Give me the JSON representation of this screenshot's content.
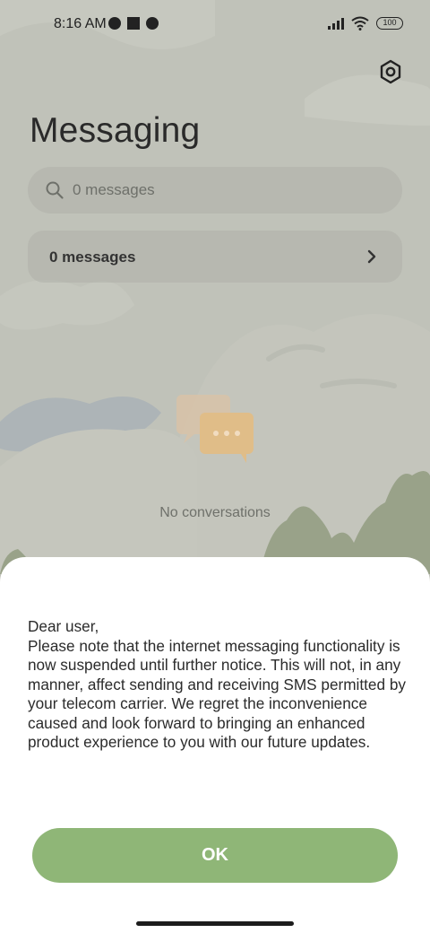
{
  "status_bar": {
    "time": "8:16 AM",
    "battery": "100"
  },
  "header": {
    "title": "Messaging",
    "settings_icon": "settings-hexagon-icon"
  },
  "search": {
    "placeholder": "0 messages",
    "icon": "search-icon"
  },
  "messages_row": {
    "label": "0 messages",
    "icon": "chevron-right-icon"
  },
  "empty_state": {
    "icon": "chat-bubbles-icon",
    "text": "No conversations"
  },
  "dialog": {
    "greeting": "Dear user,",
    "body": "Please note that the internet messaging functionality is now suspended until further notice. This will not, in any manner, affect sending and receiving SMS permitted by your telecom carrier. We regret the inconvenience caused and look forward to bringing an enhanced product experience to you with our future updates.",
    "ok_label": "OK"
  },
  "colors": {
    "accent": "#8fb677",
    "dialog_bg": "#ffffff",
    "background": "#c9cbc2"
  }
}
